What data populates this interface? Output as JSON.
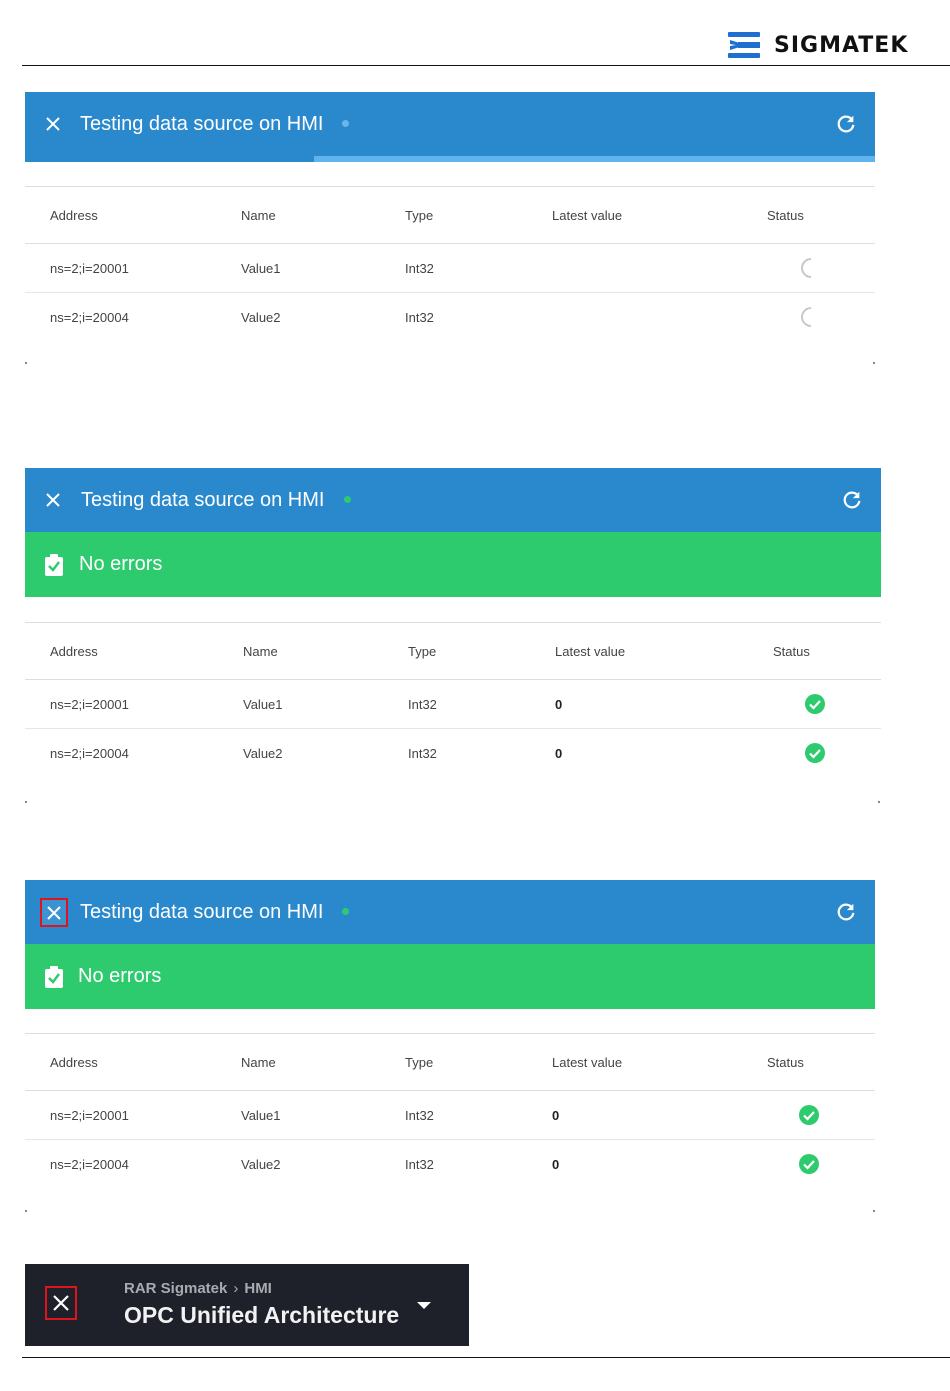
{
  "brand": {
    "name": "SIGMATEK",
    "logo_icon": "sigmatek-s-logo",
    "color": "#1f6fd0"
  },
  "colors": {
    "header_blue": "#2a89cd",
    "ok_green": "#2ecb6e",
    "highlight_red": "#e0141e"
  },
  "panels": [
    {
      "title": "Testing data source on HMI",
      "dot_color": "#6ab6e8",
      "state": "loading",
      "progress": 0.66,
      "columns": [
        "Address",
        "Name",
        "Type",
        "Latest value",
        "Status"
      ],
      "rows": [
        {
          "address": "ns=2;i=20001",
          "name": "Value1",
          "type": "Int32",
          "latest": "",
          "status": "loading"
        },
        {
          "address": "ns=2;i=20004",
          "name": "Value2",
          "type": "Int32",
          "latest": "",
          "status": "loading"
        }
      ]
    },
    {
      "title": "Testing data source on HMI",
      "dot_color": "#2ecb6e",
      "state": "ok",
      "message": "No errors",
      "columns": [
        "Address",
        "Name",
        "Type",
        "Latest value",
        "Status"
      ],
      "rows": [
        {
          "address": "ns=2;i=20001",
          "name": "Value1",
          "type": "Int32",
          "latest": "0",
          "status": "ok"
        },
        {
          "address": "ns=2;i=20004",
          "name": "Value2",
          "type": "Int32",
          "latest": "0",
          "status": "ok"
        }
      ]
    },
    {
      "title": "Testing data source on HMI",
      "dot_color": "#2ecb6e",
      "state": "ok",
      "message": "No errors",
      "columns": [
        "Address",
        "Name",
        "Type",
        "Latest value",
        "Status"
      ],
      "rows": [
        {
          "address": "ns=2;i=20001",
          "name": "Value1",
          "type": "Int32",
          "latest": "0",
          "status": "ok"
        },
        {
          "address": "ns=2;i=20004",
          "name": "Value2",
          "type": "Int32",
          "latest": "0",
          "status": "ok"
        }
      ]
    }
  ],
  "ribbon": {
    "breadcrumb": [
      "RAR Sigmatek",
      "HMI"
    ],
    "breadcrumb_sep": "›",
    "title": "OPC Unified Architecture"
  }
}
